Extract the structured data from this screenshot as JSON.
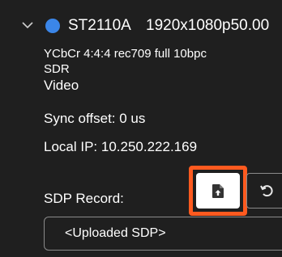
{
  "stream": {
    "name": "ST2110A",
    "format": "1920x1080p50.00",
    "dot_color": "#3b86e8",
    "expand_icon": "chevron-down-icon",
    "details": {
      "color_info": "YCbCr 4:4:4 rec709 full 10bpc",
      "dynamic_range": "SDR",
      "media_type": "Video",
      "sync_offset": "Sync offset: 0 us",
      "local_ip": "Local IP: 10.250.222.169"
    },
    "sdp": {
      "label": "SDP Record:",
      "upload_icon": "file-upload-icon",
      "revert_icon": "undo-icon",
      "selected": "<Uploaded SDP>",
      "highlight_color": "#ff5a1f"
    }
  }
}
